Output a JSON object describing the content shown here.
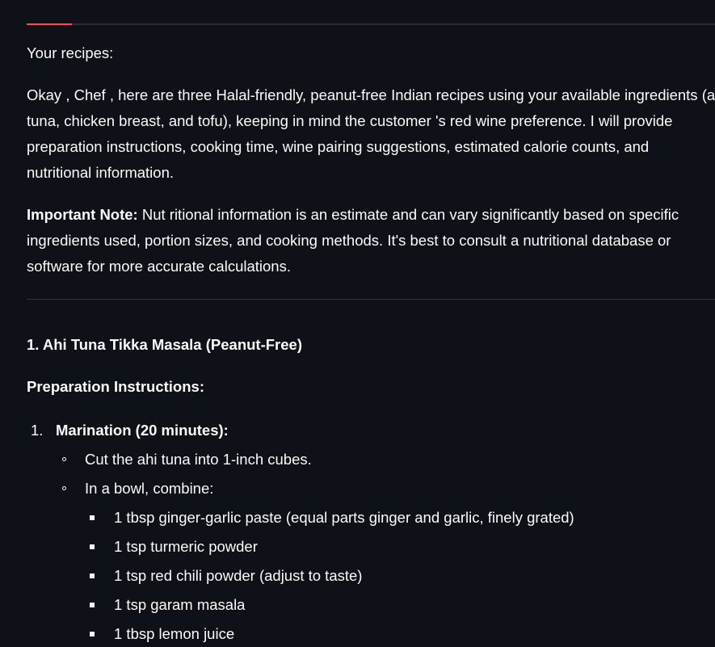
{
  "header": {
    "accent_color": "#ff4b4b"
  },
  "response": {
    "label": "Your recipes:",
    "intro_lines": [
      "Okay , Chef , here are three Halal-friendly, peanut-free Indian recipes using your available ingredients (a",
      "tuna, chicken breast, and tofu), keeping in mind the customer 's red wine preference. I will provide",
      "preparation instructions, cooking time, wine pairing suggestions, estimated calorie counts, and",
      "nutritional information."
    ],
    "note_label": "Important Note:",
    "note_lines": [
      " Nut ritional information is an estimate and can vary significantly based on specific",
      "ingredients used, portion sizes, and cooking methods. It's best to consult a nutritional database or",
      "software for more accurate calculations."
    ]
  },
  "recipe": {
    "title": "1. Ahi Tuna Tikka Masala (Peanut-Free)",
    "prep_heading": "Preparation Instructions:",
    "steps": [
      {
        "marker": "1.",
        "title": "Marination (20 minutes):",
        "items": [
          {
            "text": "Cut the ahi tuna into 1-inch cubes."
          },
          {
            "text": "In a bowl, combine:",
            "subitems": [
              "1 tbsp ginger-garlic paste (equal parts ginger and garlic, finely grated)",
              "1 tsp turmeric powder",
              "1 tsp red chili powder (adjust to taste)",
              "1 tsp garam masala",
              "1 tbsp lemon juice"
            ]
          }
        ]
      }
    ]
  }
}
